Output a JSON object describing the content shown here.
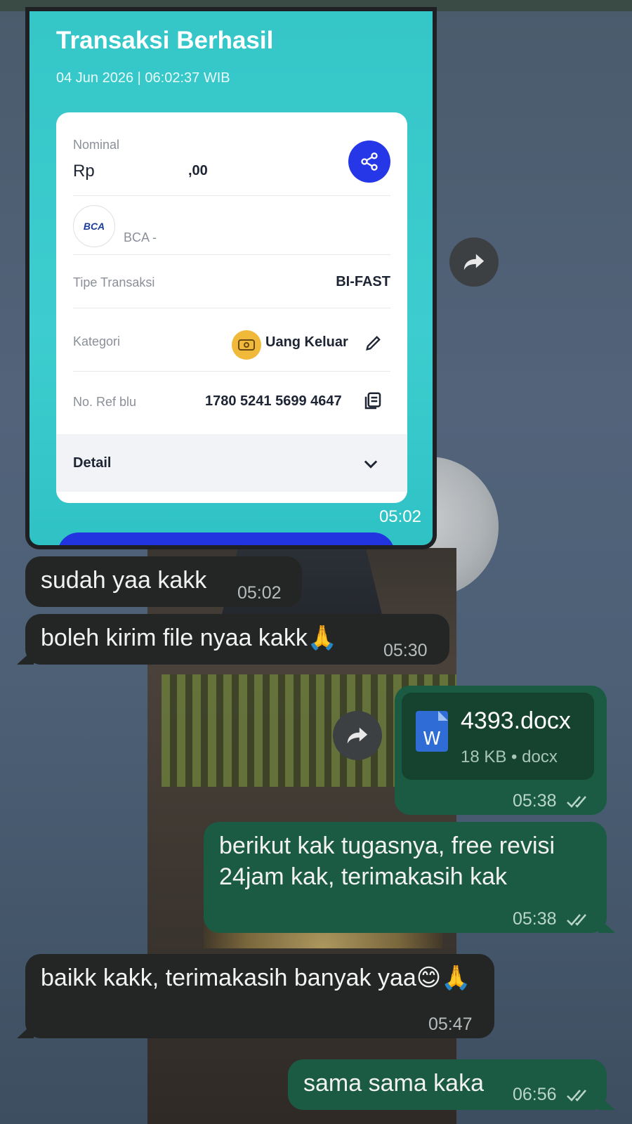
{
  "receipt": {
    "title": "Transaksi Berhasil",
    "datetime": "04 Jun 2026 | 06:02:37 WIB",
    "nominal_label": "Nominal",
    "nominal_prefix": "Rp",
    "nominal_suffix": ",00",
    "bank_logo": "BCA",
    "bank_name": "BCA -",
    "type_label": "Tipe Transaksi",
    "type_value": "BI-FAST",
    "category_label": "Kategori",
    "category_value": "Uang Keluar",
    "ref_label": "No. Ref blu",
    "ref_value": "1780 5241 5699 4647",
    "detail_label": "Detail",
    "time": "05:02"
  },
  "messages": {
    "m1": {
      "text": "sudah yaa kakk",
      "time": "05:02"
    },
    "m2": {
      "text": "boleh kirim file nyaa kakk🙏",
      "time": "05:30"
    },
    "file": {
      "name": "4393.docx",
      "meta": "18 KB • docx",
      "time": "05:38",
      "icon_letter": "W"
    },
    "m3": {
      "text": "berikut kak tugasnya, free revisi 24jam kak, terimakasih kak",
      "time": "05:38"
    },
    "m4": {
      "text": "baikk kakk, terimakasih banyak yaa😊🙏",
      "time": "05:47"
    },
    "m5": {
      "text": "sama sama kaka",
      "time": "06:56"
    }
  },
  "colors": {
    "incoming": "#242626",
    "outgoing": "#1b5a43",
    "receipt_bg": "#3dcdd0",
    "accent_blue": "#2637e8"
  },
  "icons": [
    "share-icon",
    "forward-icon",
    "pencil-icon",
    "copy-icon",
    "chevron-down-icon",
    "double-check-icon",
    "word-doc-icon",
    "money-out-icon"
  ]
}
